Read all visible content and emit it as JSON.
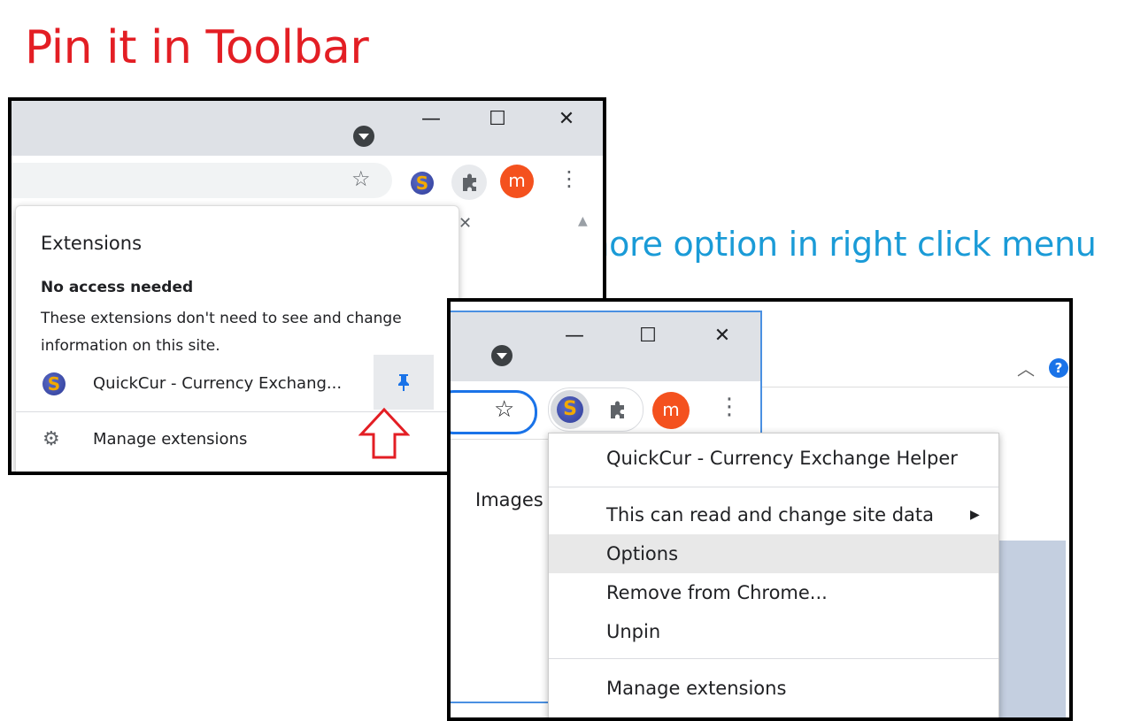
{
  "headings": {
    "pin_toolbar": "Pin it in Toolbar",
    "find_more": "Find more option in right click menu"
  },
  "window_controls": {
    "minimize": "—",
    "maximize": "☐",
    "close": "✕"
  },
  "extensions_popup": {
    "title": "Extensions",
    "section_heading": "No access needed",
    "section_description": "These extensions don't need to see and change information on this site.",
    "extension_name": "QuickCur - Currency Exchang...",
    "manage_label": "Manage extensions",
    "close_glyph": "✕"
  },
  "toolbar": {
    "avatar_letter": "m",
    "extension_letter": "S",
    "menu_glyph": "⋮",
    "star_glyph": "☆",
    "puzzle_glyph": "🧩",
    "pin_glyph": "📌"
  },
  "page": {
    "images_link": "Images",
    "help_glyph": "?"
  },
  "context_menu": {
    "items": [
      {
        "label": "QuickCur - Currency Exchange Helper"
      },
      {
        "label": "This can read and change site data",
        "submenu_arrow": "▶"
      },
      {
        "label": "Options"
      },
      {
        "label": "Remove from Chrome..."
      },
      {
        "label": "Unpin"
      },
      {
        "label": "Manage extensions"
      }
    ],
    "selected_index": 2
  },
  "colors": {
    "heading1": "#e31e24",
    "heading2": "#1a9bd7",
    "pin_active": "#1a73e8",
    "arrow": "#e31e24",
    "avatar_bg": "#f4511e"
  }
}
